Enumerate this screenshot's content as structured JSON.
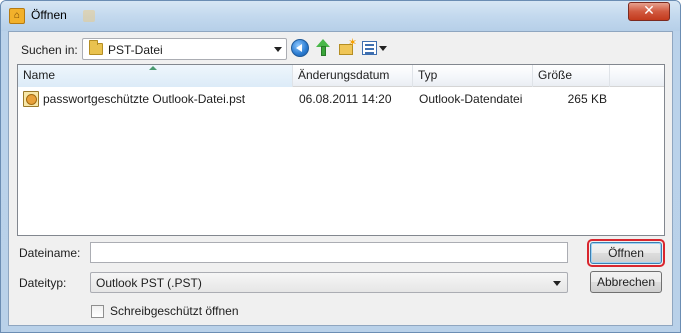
{
  "window": {
    "title": "Öffnen",
    "close_glyph": "✕",
    "app_icon": "outlook-pst-icon"
  },
  "toolbar": {
    "lookin_label": "Suchen in:",
    "lookin_value": "PST-Datei",
    "icons": [
      "back-icon",
      "up-folder-icon",
      "new-folder-icon",
      "views-menu-icon"
    ]
  },
  "filelist": {
    "columns": [
      "Name",
      "Änderungsdatum",
      "Typ",
      "Größe"
    ],
    "sorted_column": "Name",
    "rows": [
      {
        "name": "passwortgeschützte Outlook-Datei.pst",
        "date": "06.08.2011 14:20",
        "type": "Outlook-Datendatei",
        "size": "265 KB"
      }
    ]
  },
  "form": {
    "filename_label": "Dateiname:",
    "filename_value": "",
    "filetype_label": "Dateityp:",
    "filetype_value": "Outlook PST (.PST)",
    "readonly_label": "Schreibgeschützt öffnen",
    "readonly_checked": false
  },
  "buttons": {
    "open": "Öffnen",
    "cancel": "Abbrechen"
  },
  "colors": {
    "title_gradient_top": "#d7e6f4",
    "close_button": "#c33a1d",
    "highlight_ring": "#d9262e"
  }
}
